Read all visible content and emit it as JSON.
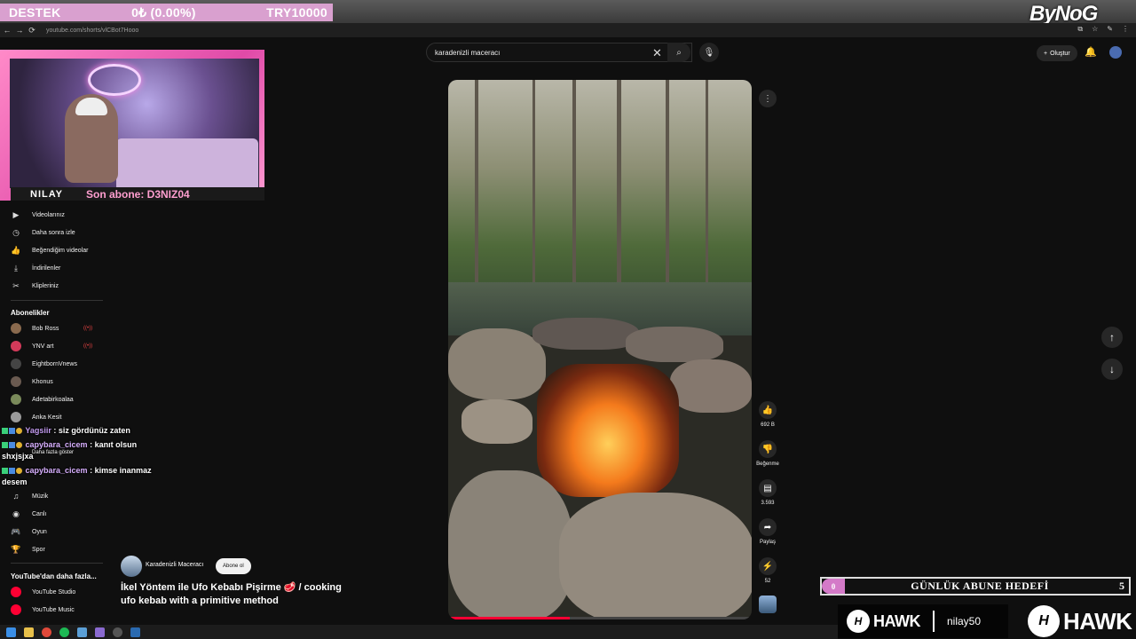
{
  "stream_banner": {
    "donate_label": "DESTEK",
    "donate_amount": "0₺ (0.00%)",
    "donate_goal": "TRY10000",
    "watermark": "ByNoG"
  },
  "browser": {
    "url": "youtube.com/shorts/vlCBot7Hooo"
  },
  "webcam": {
    "streamer_name": "NILAY",
    "last_sub": "Son abone: D3NIZ04"
  },
  "search": {
    "query": "karadenizli maceracı"
  },
  "header": {
    "create_label": "Oluştur"
  },
  "sidebar": {
    "library": [
      {
        "icon": "video-icon",
        "label": "Videolarınız"
      },
      {
        "icon": "clock-icon",
        "label": "Daha sonra izle"
      },
      {
        "icon": "thumbs-up-icon",
        "label": "Beğendiğim videolar"
      },
      {
        "icon": "download-icon",
        "label": "İndirilenler"
      },
      {
        "icon": "scissors-icon",
        "label": "Klipleriniz"
      }
    ],
    "subs_heading": "Abonelikler",
    "subscriptions": [
      {
        "label": "Bob Ross",
        "color": "#8a6a4e"
      },
      {
        "label": "YNV art",
        "color": "#d33a5a"
      },
      {
        "label": "EightbornVnews",
        "color": "#444444"
      },
      {
        "label": "Khonus",
        "color": "#6a5a50"
      },
      {
        "label": "Adetabirkoalaa",
        "color": "#7a8a5a"
      },
      {
        "label": "Anka Kesit",
        "color": "#9a9a9a"
      }
    ],
    "show_more": "Daha fazla göster",
    "explore": [
      {
        "icon": "music-icon",
        "label": "Müzik"
      },
      {
        "icon": "live-icon",
        "label": "Canlı"
      },
      {
        "icon": "gamepad-icon",
        "label": "Oyun"
      },
      {
        "icon": "trophy-icon",
        "label": "Spor"
      }
    ],
    "more_heading": "YouTube'dan daha fazla...",
    "more": [
      {
        "label": "YouTube Studio"
      },
      {
        "label": "YouTube Music"
      }
    ]
  },
  "chat": [
    {
      "user": "Yagsiir",
      "message": ": siz gördünüz zaten"
    },
    {
      "user": "capybara_cicem",
      "message": ": kanıt olsun",
      "continuation": "shxjsjxa"
    },
    {
      "user": "capybara_cicem",
      "message": ": kimse inanmaz",
      "continuation": "desem"
    }
  ],
  "video": {
    "progress": 0.4
  },
  "actions": {
    "like_count": "692 B",
    "dislike_label": "Beğenme",
    "comment_count": "3.593",
    "share_label": "Paylaş",
    "remix_count": "52"
  },
  "channel": {
    "name": "Karadenizli Maceracı",
    "subscribe_label": "Abone ol",
    "title": "İkel Yöntem ile Ufo Kebabı Pişirme 🥩 / cooking ufo kebab with a primitive method"
  },
  "goal": {
    "current": "0",
    "label": "GÜNLÜK ABUNE HEDEFİ",
    "target": "5"
  },
  "sponsor": {
    "brand": "HAWK",
    "code": "nilay50"
  }
}
